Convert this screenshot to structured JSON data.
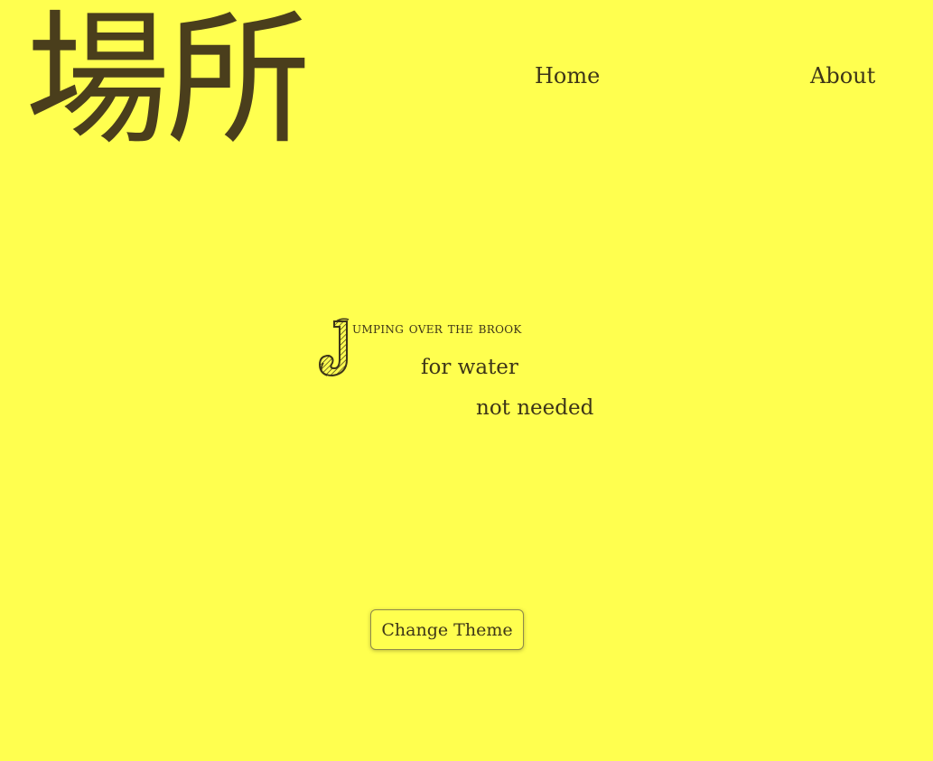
{
  "header": {
    "logo_text": "場所",
    "nav": {
      "home_label": "Home",
      "about_label": "About"
    }
  },
  "poem": {
    "drop_cap": "J",
    "line1_rest": "umping over the brook",
    "line2": "for water",
    "line3": "not needed"
  },
  "controls": {
    "change_theme_label": "Change Theme"
  },
  "colors": {
    "background": "#ffff4f",
    "text": "#3d3518"
  }
}
